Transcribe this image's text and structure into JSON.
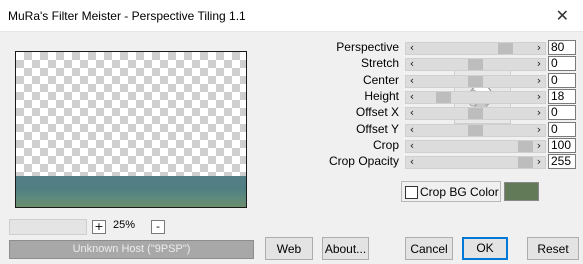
{
  "window": {
    "title": "MuRa's Filter Meister - Perspective Tiling 1.1"
  },
  "zoom": {
    "minus_label": "-",
    "plus_label": "+",
    "level": "25%"
  },
  "status": {
    "host_text": "Unknown Host (\"9PSP\")"
  },
  "buttons": {
    "web": "Web",
    "about": "About...",
    "cancel": "Cancel",
    "ok": "OK",
    "reset": "Reset"
  },
  "params": [
    {
      "label": "Perspective",
      "value": "80",
      "fraction": 0.8
    },
    {
      "label": "Stretch",
      "value": "0",
      "fraction": 0.5
    },
    {
      "label": "Center",
      "value": "0",
      "fraction": 0.5
    },
    {
      "label": "Height",
      "value": "18",
      "fraction": 0.18
    },
    {
      "label": "Offset X",
      "value": "0",
      "fraction": 0.5
    },
    {
      "label": "Offset Y",
      "value": "0",
      "fraction": 0.5
    },
    {
      "label": "Crop",
      "value": "100",
      "fraction": 1.0
    },
    {
      "label": "Crop Opacity",
      "value": "255",
      "fraction": 1.0
    }
  ],
  "crop_bg": {
    "label": "Crop BG Color",
    "checked": false,
    "color": "#627a57"
  },
  "colors": {
    "preview_tile": "#557e86",
    "focus_blue": "#0078d7"
  }
}
